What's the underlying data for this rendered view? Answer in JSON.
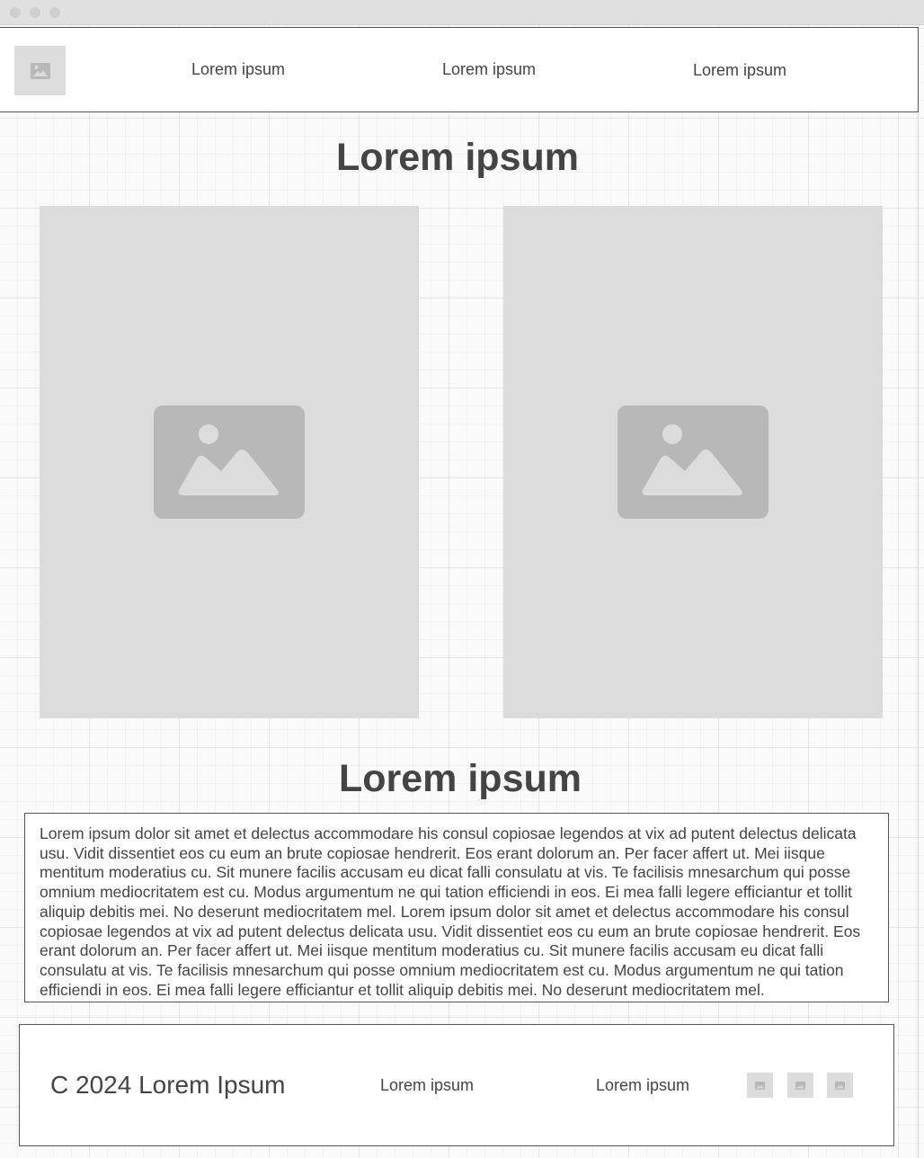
{
  "header": {
    "logo_icon": "image-placeholder-icon",
    "nav": [
      {
        "label": "Lorem ipsum"
      },
      {
        "label": "Lorem ipsum"
      },
      {
        "label": "Lorem ipsum"
      }
    ]
  },
  "main": {
    "title": "Lorem ipsum",
    "cards": [
      {
        "icon": "image-placeholder-icon"
      },
      {
        "icon": "image-placeholder-icon"
      }
    ],
    "section_title": "Lorem ipsum",
    "body_text": "Lorem ipsum dolor sit amet et delectus accommodare his consul copiosae legendos at vix ad putent delectus delicata usu. Vidit dissentiet eos cu eum an brute copiosae hendrerit. Eos erant dolorum an. Per facer affert ut. Mei iisque mentitum moderatius cu. Sit munere facilis accusam eu dicat falli consulatu at vis. Te facilisis mnesarchum qui posse omnium mediocritatem est cu. Modus argumentum ne qui tation efficiendi in eos. Ei mea falli legere efficiantur et tollit aliquip debitis mei. No deserunt mediocritatem mel. Lorem ipsum dolor sit amet et delectus accommodare his consul copiosae legendos at vix ad putent delectus delicata usu. Vidit dissentiet eos cu eum an brute copiosae hendrerit. Eos erant dolorum an. Per facer affert ut. Mei iisque mentitum moderatius cu. Sit munere facilis accusam eu dicat falli consulatu at vis. Te facilisis mnesarchum qui posse omnium mediocritatem est cu. Modus argumentum ne qui tation efficiendi in eos. Ei mea falli legere efficiantur et tollit aliquip debitis mei. No deserunt mediocritatem mel."
  },
  "footer": {
    "copyright": "C 2024 Lorem Ipsum",
    "links": [
      {
        "label": "Lorem ipsum"
      },
      {
        "label": "Lorem ipsum"
      }
    ],
    "social_icons": [
      "image-placeholder-icon",
      "image-placeholder-icon",
      "image-placeholder-icon"
    ]
  },
  "colors": {
    "placeholder_bg": "#dcdcdc",
    "placeholder_icon": "#b8b8b8",
    "text": "#444444",
    "border": "#555555"
  }
}
